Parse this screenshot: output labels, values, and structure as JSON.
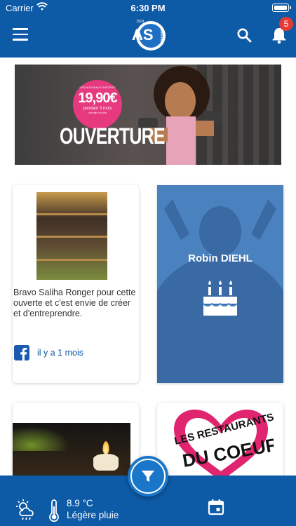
{
  "status_bar": {
    "carrier": "Carrier",
    "time": "6:30 PM"
  },
  "header": {
    "logo": {
      "letters": "AS",
      "club": "ERSTEIN",
      "year": "1919"
    },
    "notification_count": "5"
  },
  "banner": {
    "price_top": "LES NOUVEAUX INSCRITS",
    "price": "19,90€",
    "price_sub": "pendant 3 mois",
    "price_note": "voir offre en club",
    "headline": "OUVERTURE"
  },
  "posts": [
    {
      "text": "Bravo Saliha Ronger pour cette ouverte et c'est envie de créer et d'entreprendre.",
      "source": "facebook",
      "time": "il y a 1 mois"
    },
    {
      "name": "Robin DIEHL",
      "type": "birthday"
    }
  ],
  "restos_logo": {
    "line1": "LES RESTAURANTS",
    "line2": "DU COEUR"
  },
  "weather": {
    "temperature": "8.9 °C",
    "condition": "Légère pluie"
  },
  "colors": {
    "primary": "#0d5aa7",
    "accent": "#1976c9",
    "badge": "#e53935",
    "card_blue": "#4a82c0"
  },
  "icons": [
    "menu-icon",
    "search-icon",
    "bell-icon",
    "facebook-icon",
    "cake-icon",
    "filter-icon",
    "weather-icon",
    "thermometer-icon",
    "calendar-icon"
  ]
}
